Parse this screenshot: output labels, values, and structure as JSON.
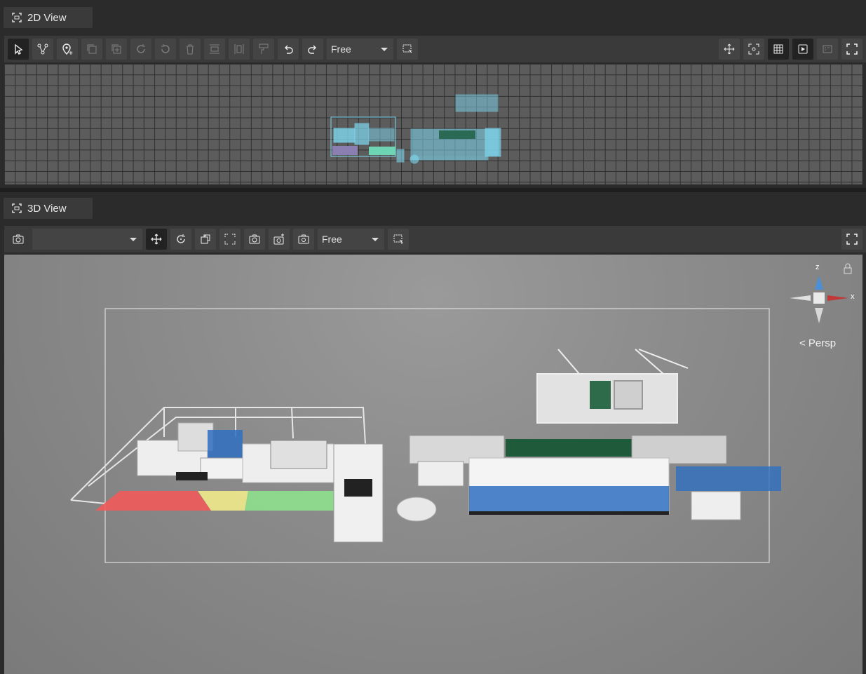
{
  "panel2d": {
    "title": "2D View",
    "icons": [
      "select-arrow-icon",
      "branch-nodes-icon",
      "add-location-icon",
      "copy-icon",
      "add-copy-icon",
      "rotate-cw-icon",
      "rotate-ccw-icon",
      "trash-icon",
      "align-horizontal-icon",
      "align-vertical-icon",
      "paint-format-icon",
      "undo-icon",
      "redo-icon"
    ],
    "mode_value": "Free",
    "right_icons": [
      "move-arrows-icon",
      "focus-frame-icon",
      "grid-icon",
      "play-frame-icon",
      "pdf-icon",
      "fullscreen-icon"
    ]
  },
  "panel3d": {
    "title": "3D View",
    "camera_select_value": "",
    "mode_value": "Free",
    "gizmo": {
      "z_label": "z",
      "x_label": "x",
      "projection": "< Persp"
    }
  },
  "colors": {
    "zone_red": "#f25a5a",
    "zone_yellow": "#f2ea8c",
    "zone_green": "#8ee08e",
    "machine_blue": "#2f6fc0",
    "belt_green": "#1f5a3a",
    "blueprint_cyan": "#7fd8f0"
  }
}
